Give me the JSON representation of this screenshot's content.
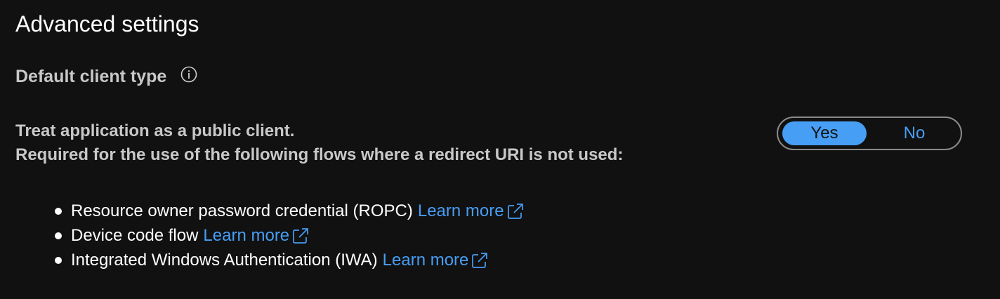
{
  "section": {
    "title": "Advanced settings"
  },
  "default_client_type": {
    "label": "Default client type",
    "info_icon": "info-icon"
  },
  "public_client": {
    "description_line1": "Treat application as a public client.",
    "description_line2": "Required for the use of the following flows where a redirect URI is not used:",
    "toggle": {
      "options": [
        "Yes",
        "No"
      ],
      "selected": "Yes"
    }
  },
  "flows": [
    {
      "text": "Resource owner password credential (ROPC)",
      "link": "Learn more",
      "icon": "external-link-icon"
    },
    {
      "text": "Device code flow",
      "link": "Learn more",
      "icon": "external-link-icon"
    },
    {
      "text": "Integrated Windows Authentication (IWA)",
      "link": "Learn more",
      "icon": "external-link-icon"
    }
  ],
  "colors": {
    "background": "#111111",
    "accent": "#479ef5",
    "muted_text": "#c8c8c8",
    "text": "#ffffff"
  }
}
